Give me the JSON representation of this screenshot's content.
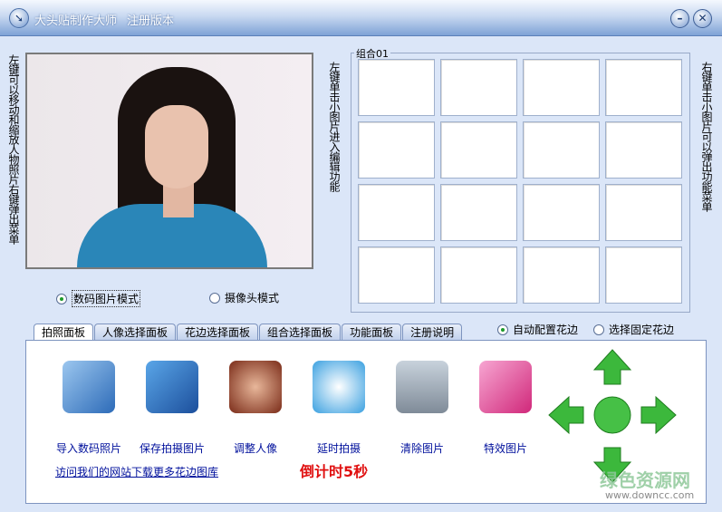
{
  "window": {
    "title": "大头贴制作大师",
    "edition": "注册版本"
  },
  "hints": {
    "left": "左键可以移动和缩放人物照片右键弹出菜单",
    "middle": "左键单击小图片进入编辑功能",
    "right": "右键单击小图片可以弹出功能菜单"
  },
  "group": {
    "label": "组合01"
  },
  "modes": [
    {
      "label": "数码图片模式",
      "selected": true
    },
    {
      "label": "摄像头模式",
      "selected": false
    }
  ],
  "border_modes": [
    {
      "label": "自动配置花边",
      "selected": true
    },
    {
      "label": "选择固定花边",
      "selected": false
    }
  ],
  "tabs": [
    {
      "label": "拍照面板",
      "active": true
    },
    {
      "label": "人像选择面板"
    },
    {
      "label": "花边选择面板"
    },
    {
      "label": "组合选择面板"
    },
    {
      "label": "功能面板"
    },
    {
      "label": "注册说明"
    }
  ],
  "tools": [
    {
      "label": "导入数码照片",
      "icon": "camera-photo-icon"
    },
    {
      "label": "保存拍摄图片",
      "icon": "floppy-save-icon"
    },
    {
      "label": "调整人像",
      "icon": "portrait-icon"
    },
    {
      "label": "延时拍摄",
      "icon": "compass-timer-icon"
    },
    {
      "label": "清除图片",
      "icon": "trash-bin-icon"
    },
    {
      "label": "特效图片",
      "icon": "effects-icon"
    }
  ],
  "link": "访问我们的网站下载更多花边图库",
  "countdown": "倒计时5秒",
  "watermark": {
    "name": "绿色资源网",
    "url": "www.downcc.com"
  }
}
